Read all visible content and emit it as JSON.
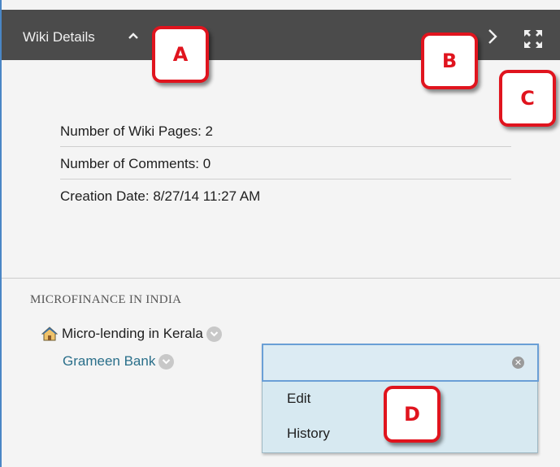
{
  "header": {
    "title": "Wiki Details"
  },
  "callouts": {
    "a": "A",
    "b": "B",
    "c": "C",
    "d": "D"
  },
  "stats": [
    {
      "label": "Number of Wiki Pages: 2"
    },
    {
      "label": "Number of Comments: 0"
    },
    {
      "label": "Creation Date: 8/27/14 11:27 AM"
    }
  ],
  "pages": {
    "heading": "MICROFINANCE IN INDIA",
    "home_page": "Micro-lending in Kerala",
    "sub_page": "Grameen Bank"
  },
  "dropdown": {
    "items": [
      {
        "label": "Edit"
      },
      {
        "label": "History"
      }
    ]
  },
  "icons": {
    "caret": "chevron-up-icon",
    "next": "chevron-right-icon",
    "expand": "expand-icon",
    "home": "home-icon",
    "menu": "chevron-down-circle-icon",
    "clear": "clear-icon"
  },
  "colors": {
    "header_bg": "#4b4b4b",
    "panel_bg": "#f4f4f4",
    "link": "#2a6f8a",
    "callout": "#e0141e",
    "dropdown_bg": "#d7e9f1",
    "focus_border": "#6a9fd6"
  }
}
